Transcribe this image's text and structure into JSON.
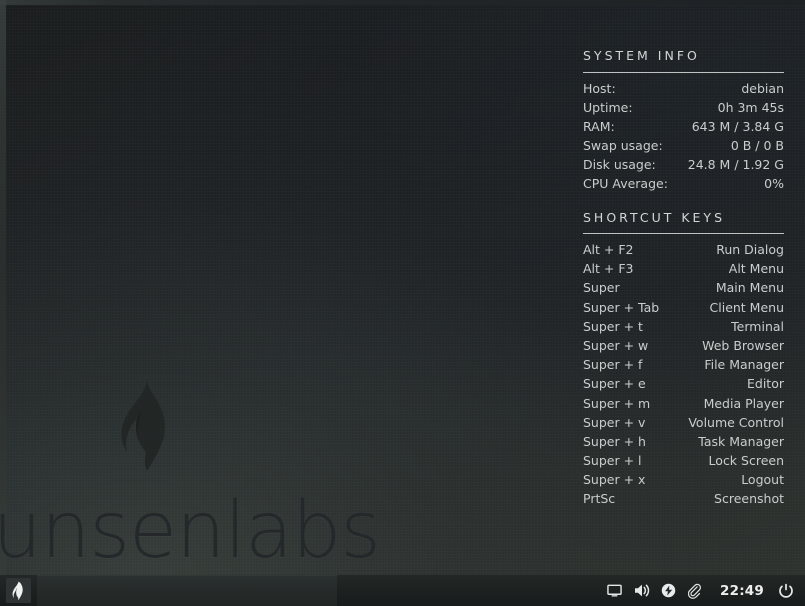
{
  "desktop": {
    "wallpaper_brand": "bunsenlabs",
    "flame_icon": "bunsenlabs-flame-icon",
    "bg_color": "#21262a",
    "accent_color": "#c9cdcc"
  },
  "conky": {
    "system_info": {
      "heading": "SYSTEM INFO",
      "rows": [
        {
          "key": "Host:",
          "value": "debian"
        },
        {
          "key": "Uptime:",
          "value": "0h 3m 45s"
        },
        {
          "key": "RAM:",
          "value": "643 M / 3.84 G"
        },
        {
          "key": "Swap usage:",
          "value": "0 B / 0 B"
        },
        {
          "key": "Disk usage:",
          "value": "24.8 M / 1.92 G"
        },
        {
          "key": "CPU Average:",
          "value": "0%"
        }
      ]
    },
    "shortcut_keys": {
      "heading": "SHORTCUT KEYS",
      "rows": [
        {
          "key": "Alt + F2",
          "action": "Run Dialog"
        },
        {
          "key": "Alt + F3",
          "action": "Alt Menu"
        },
        {
          "key": "Super",
          "action": "Main Menu"
        },
        {
          "key": "Super + Tab",
          "action": "Client Menu"
        },
        {
          "key": "Super + t",
          "action": "Terminal"
        },
        {
          "key": "Super + w",
          "action": "Web Browser"
        },
        {
          "key": "Super + f",
          "action": "File Manager"
        },
        {
          "key": "Super + e",
          "action": "Editor"
        },
        {
          "key": "Super + m",
          "action": "Media Player"
        },
        {
          "key": "Super + v",
          "action": "Volume Control"
        },
        {
          "key": "Super + h",
          "action": "Task Manager"
        },
        {
          "key": "Super + l",
          "action": "Lock Screen"
        },
        {
          "key": "Super + x",
          "action": "Logout"
        },
        {
          "key": "PrtSc",
          "action": "Screenshot"
        }
      ]
    }
  },
  "taskbar": {
    "launcher_icon": "bunsenlabs-flame-icon",
    "tray": [
      {
        "icon": "display-monitor-icon"
      },
      {
        "icon": "volume-speaker-icon"
      },
      {
        "icon": "update-notifier-icon"
      },
      {
        "icon": "clipboard-paperclip-icon"
      }
    ],
    "clock": "22:49",
    "power_icon": "power-button-icon"
  }
}
